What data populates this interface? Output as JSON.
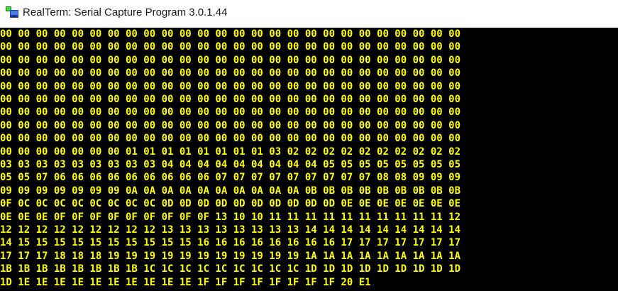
{
  "window": {
    "title": "RealTerm: Serial Capture Program 3.0.1.44",
    "icon": "realterm-app-icon"
  },
  "terminal": {
    "text_color": "#ffff00",
    "background_color": "#000000",
    "lines": [
      "00 00 00 00 00 00 00 00 00 00 00 00 00 00 00 00 00 00 00 00 00 00 00 00 00 00",
      "00 00 00 00 00 00 00 00 00 00 00 00 00 00 00 00 00 00 00 00 00 00 00 00 00 00",
      "00 00 00 00 00 00 00 00 00 00 00 00 00 00 00 00 00 00 00 00 00 00 00 00 00 00",
      "00 00 00 00 00 00 00 00 00 00 00 00 00 00 00 00 00 00 00 00 00 00 00 00 00 00",
      "00 00 00 00 00 00 00 00 00 00 00 00 00 00 00 00 00 00 00 00 00 00 00 00 00 00",
      "00 00 00 00 00 00 00 00 00 00 00 00 00 00 00 00 00 00 00 00 00 00 00 00 00 00",
      "00 00 00 00 00 00 00 00 00 00 00 00 00 00 00 00 00 00 00 00 00 00 00 00 00 00",
      "00 00 00 00 00 00 00 00 00 00 00 00 00 00 00 00 00 00 00 00 00 00 00 00 00 00",
      "00 00 00 00 00 00 00 00 00 00 00 00 00 00 00 00 00 00 00 00 00 00 00 00 00 00",
      "00 00 00 00 00 00 00 01 01 01 01 01 01 01 01 03 02 02 02 02 02 02 02 02 02 02",
      "03 03 03 03 03 03 03 03 03 04 04 04 04 04 04 04 04 04 05 05 05 05 05 05 05 05",
      "05 05 07 06 06 06 06 06 06 06 06 06 07 07 07 07 07 07 07 07 07 08 08 09 09 09",
      "09 09 09 09 09 09 09 0A 0A 0A 0A 0A 0A 0A 0A 0A 0A 0B 0B 0B 0B 0B 0B 0B 0B 0B",
      "0F 0C 0C 0C 0C 0C 0C 0C 0C 0D 0D 0D 0D 0D 0D 0D 0D 0D 0D 0E 0E 0E 0E 0E 0E 0E",
      "0E 0E 0E 0F 0F 0F 0F 0F 0F 0F 0F 0F 13 10 10 11 11 11 11 11 11 11 11 11 11 12",
      "12 12 12 12 12 12 12 12 12 13 13 13 13 13 13 13 13 14 14 14 14 14 14 14 14 14",
      "14 15 15 15 15 15 15 15 15 15 15 16 16 16 16 16 16 16 16 17 17 17 17 17 17 17",
      "17 17 17 18 18 18 19 19 19 19 19 19 19 19 19 19 19 1A 1A 1A 1A 1A 1A 1A 1A 1A",
      "1B 1B 1B 1B 1B 1B 1B 1B 1C 1C 1C 1C 1C 1C 1C 1C 1C 1D 1D 1D 1D 1D 1D 1D 1D 1D",
      "1D 1E 1E 1E 1E 1E 1E 1E 1E 1E 1E 1F 1F 1F 1F 1F 1F 1F 1F 20 E1"
    ]
  }
}
